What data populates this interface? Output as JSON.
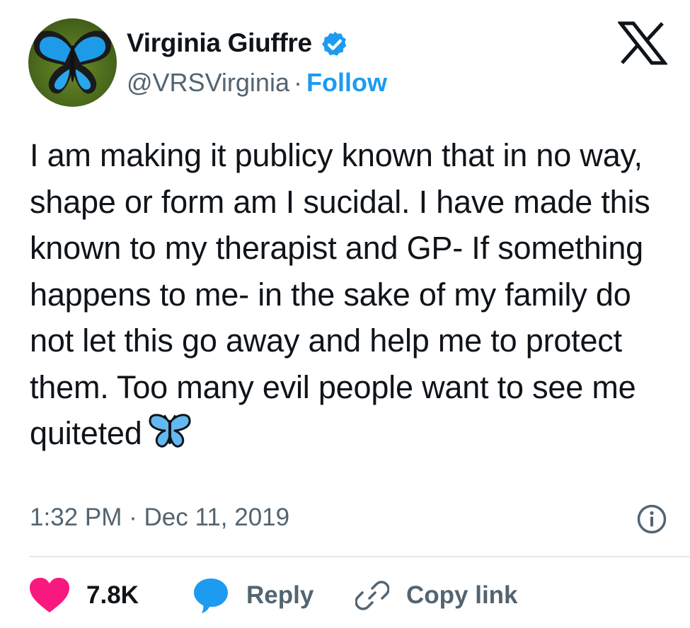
{
  "author": {
    "name": "Virginia Giuffre",
    "handle": "@VRSVirginia",
    "separator": "·",
    "follow_label": "Follow",
    "verified": true
  },
  "tweet": {
    "text": "I am making it publicy known that in no way, shape or form am I sucidal. I have made this known to my therapist and GP- If something happens to me- in the sake of my family do not let this go away and help me to protect them. Too many evil people want to see me quiteted",
    "emoji": "butterfly-emoji",
    "time": "1:32 PM",
    "date": "Dec 11, 2019",
    "separator": "·"
  },
  "actions": {
    "like_count": "7.8K",
    "reply_label": "Reply",
    "copy_link_label": "Copy link"
  },
  "colors": {
    "accent": "#1d9bf0",
    "like": "#f91880",
    "text": "#0f1419",
    "secondary": "#536471"
  },
  "icons": [
    "avatar-butterfly",
    "verified-badge-icon",
    "x-logo-icon",
    "info-icon",
    "heart-icon",
    "reply-bubble-icon",
    "link-icon"
  ]
}
